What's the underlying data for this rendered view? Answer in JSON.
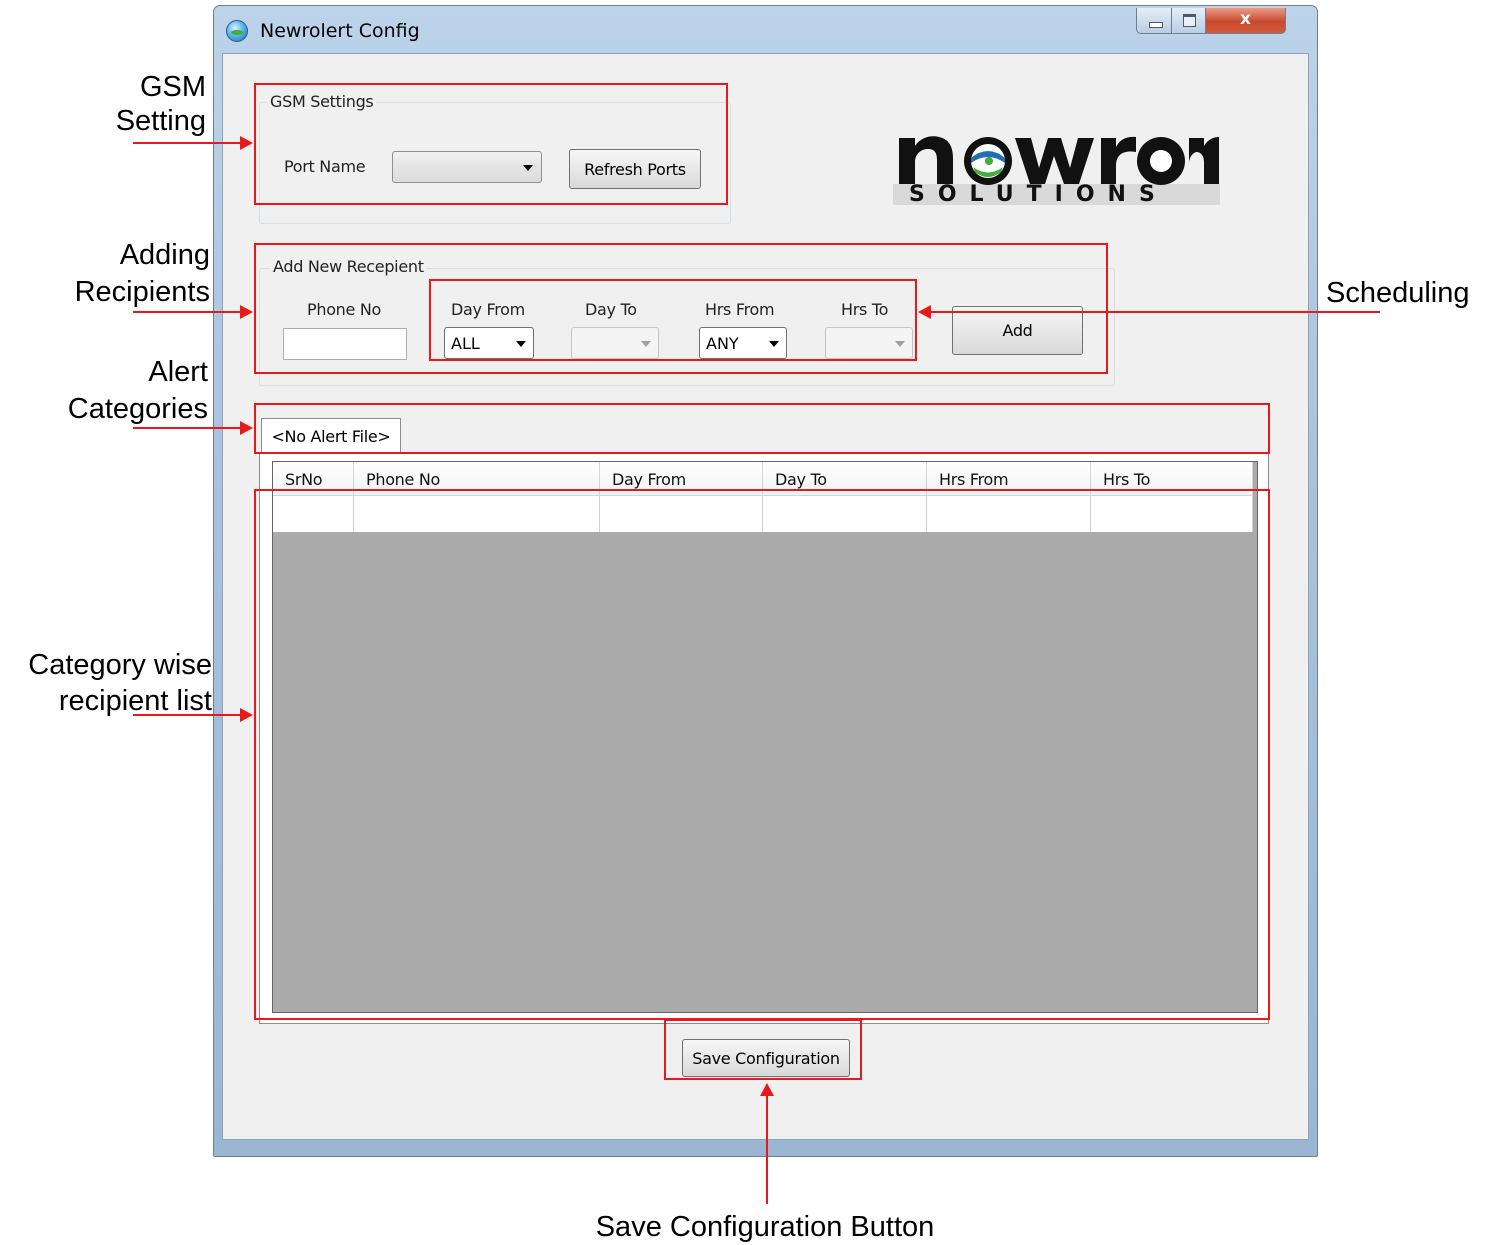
{
  "window": {
    "title": "Newrolert Config",
    "close_glyph": "x"
  },
  "gsm": {
    "legend": "GSM Settings",
    "port_label": "Port Name",
    "port_value": "",
    "refresh_button": "Refresh Ports"
  },
  "logo": {
    "word": "newron",
    "subword": "SOLUTIONS"
  },
  "recipient": {
    "legend": "Add New Recepient",
    "phone_label": "Phone No",
    "phone_value": "",
    "day_from_label": "Day From",
    "day_from_value": "ALL",
    "day_to_label": "Day To",
    "day_to_value": "",
    "hrs_from_label": "Hrs From",
    "hrs_from_value": "ANY",
    "hrs_to_label": "Hrs To",
    "hrs_to_value": "",
    "add_button": "Add"
  },
  "tabs": [
    {
      "label": "<No Alert File>"
    }
  ],
  "table": {
    "columns": [
      "SrNo",
      "Phone No",
      "Day From",
      "Day To",
      "Hrs From",
      "Hrs To"
    ],
    "rows": [
      [
        "",
        "",
        "",
        "",
        "",
        ""
      ]
    ]
  },
  "save_button": "Save Configuration",
  "annotations": {
    "gsm": "GSM\nSetting",
    "gsm_line1": "GSM",
    "gsm_line2": "Setting",
    "adding_line1": "Adding",
    "adding_line2": "Recipients",
    "alert_line1": "Alert",
    "alert_line2": "Categories",
    "list_line1": "Category wise",
    "list_line2": "recipient list",
    "scheduling": "Scheduling",
    "save": "Save Configuration Button"
  },
  "colors": {
    "annotation_red": "#e8191c",
    "grid_background": "#ababab",
    "logo_green": "#3fae3a",
    "logo_blue": "#1f6fb2"
  },
  "icons": {
    "app": "newrolert-globe-icon",
    "minimize": "minimize-icon",
    "maximize": "maximize-icon",
    "close": "close-icon",
    "dropdown": "chevron-down-icon"
  }
}
